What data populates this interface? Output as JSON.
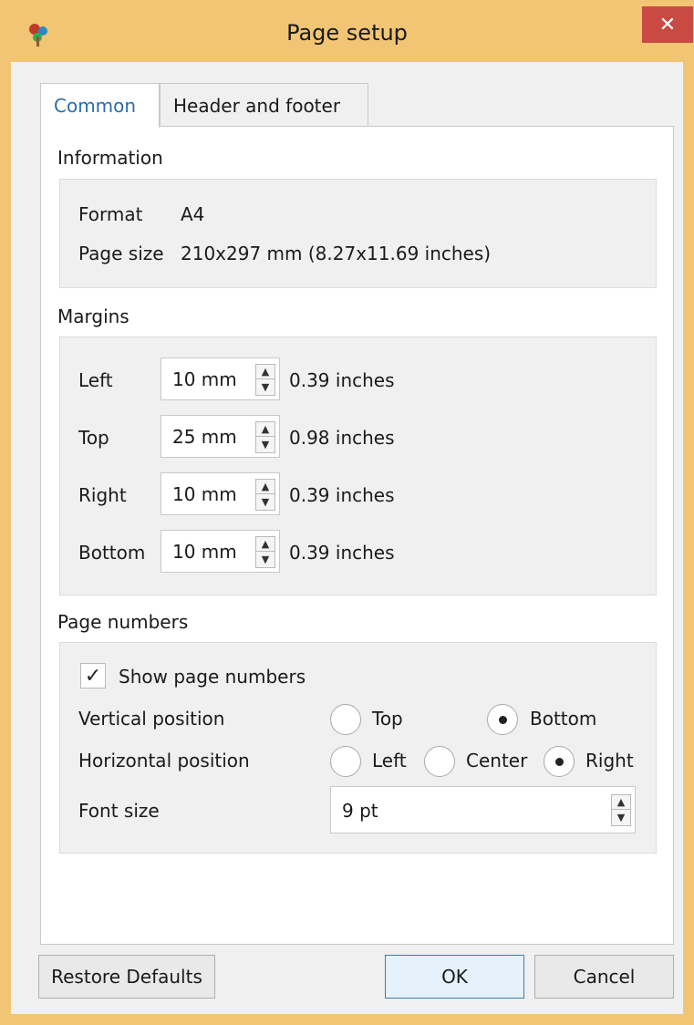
{
  "window": {
    "title": "Page setup",
    "close_label": "✕",
    "accent_color": "#f1c573",
    "close_color": "#c84a42"
  },
  "tabs": [
    {
      "label": "Common",
      "active": true
    },
    {
      "label": "Header and footer",
      "active": false
    }
  ],
  "information": {
    "section_label": "Information",
    "format_label": "Format",
    "format_value": "A4",
    "page_size_label": "Page size",
    "page_size_value": "210x297 mm (8.27x11.69 inches)"
  },
  "margins": {
    "section_label": "Margins",
    "rows": [
      {
        "label": "Left",
        "value": "10 mm",
        "inches": "0.39 inches"
      },
      {
        "label": "Top",
        "value": "25 mm",
        "inches": "0.98 inches"
      },
      {
        "label": "Right",
        "value": "10 mm",
        "inches": "0.39 inches"
      },
      {
        "label": "Bottom",
        "value": "10 mm",
        "inches": "0.39 inches"
      }
    ]
  },
  "page_numbers": {
    "section_label": "Page numbers",
    "show_label": "Show page numbers",
    "show_checked": true,
    "checkmark": "✓",
    "vertical_label": "Vertical position",
    "vertical_options": [
      {
        "label": "Top",
        "checked": false
      },
      {
        "label": "Bottom",
        "checked": true
      }
    ],
    "horizontal_label": "Horizontal position",
    "horizontal_options": [
      {
        "label": "Left",
        "checked": false
      },
      {
        "label": "Center",
        "checked": false
      },
      {
        "label": "Right",
        "checked": true
      }
    ],
    "font_size_label": "Font size",
    "font_size_value": "9 pt"
  },
  "buttons": {
    "restore": "Restore Defaults",
    "ok": "OK",
    "cancel": "Cancel"
  },
  "icons": {
    "up_arrow": "▲",
    "down_arrow": "▼"
  }
}
